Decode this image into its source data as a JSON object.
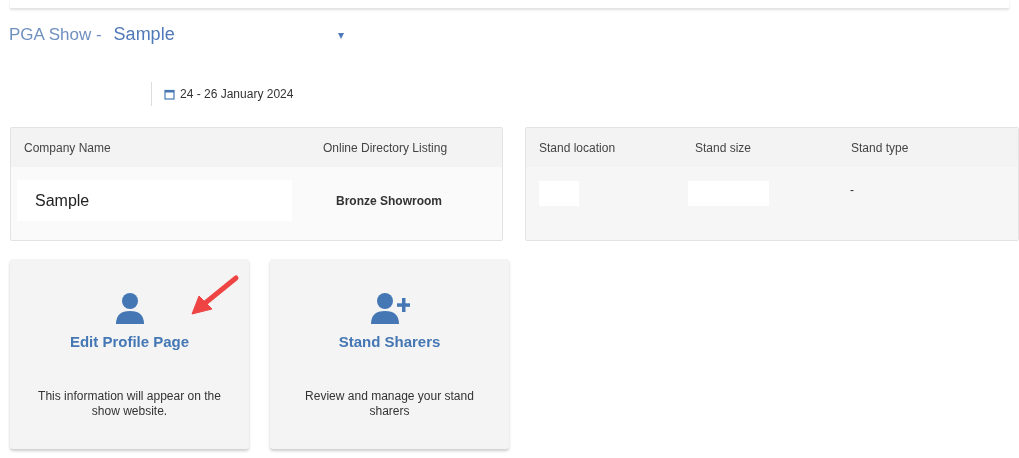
{
  "header": {
    "prefix": "PGA Show -",
    "show_name": "Sample",
    "dropdown_caret": "▾"
  },
  "dates": "24 - 26 January 2024",
  "company_panel": {
    "columns": [
      "Company Name",
      "Online Directory Listing"
    ],
    "company_name": "Sample",
    "listing": "Bronze Showroom"
  },
  "stand_panel": {
    "columns": [
      "Stand location",
      "Stand size",
      "Stand type"
    ],
    "stand_type": "-"
  },
  "cards": [
    {
      "kind": "person",
      "title": "Edit Profile Page",
      "description": "This information will appear on the show website.",
      "annotated": true
    },
    {
      "kind": "person-plus",
      "title": "Stand Sharers",
      "description": "Review and manage your stand sharers",
      "annotated": false
    }
  ]
}
